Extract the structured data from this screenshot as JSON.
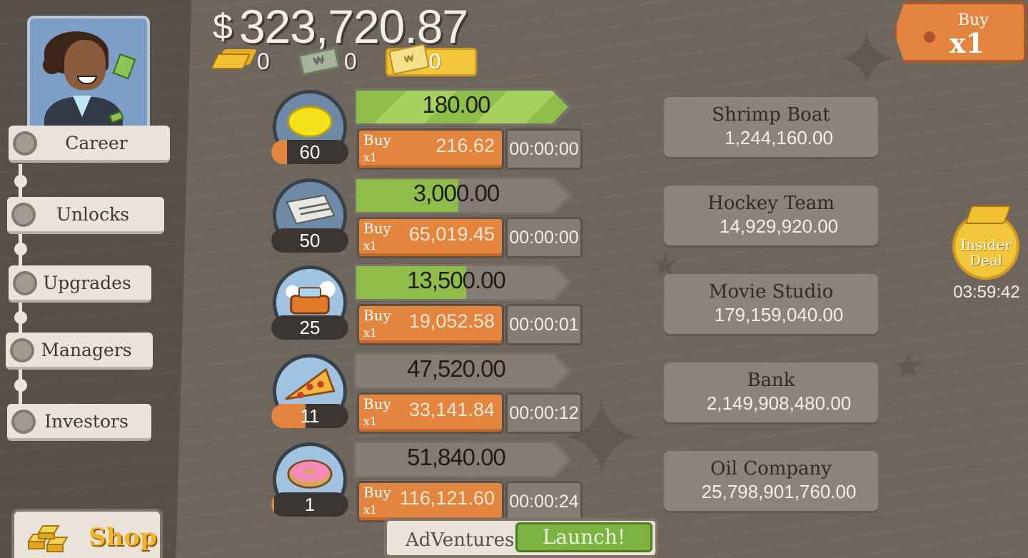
{
  "money": {
    "symbol": "$",
    "value": "323,720.87"
  },
  "currencies": {
    "gold": "0",
    "megabucks": "0",
    "tickets": "0"
  },
  "sidebar": {
    "items": [
      {
        "label": "Career"
      },
      {
        "label": "Unlocks"
      },
      {
        "label": "Upgrades"
      },
      {
        "label": "Managers"
      },
      {
        "label": "Investors"
      }
    ],
    "shop_label": "Shop"
  },
  "businesses": [
    {
      "icon": "lemon-icon",
      "count": "60",
      "count_progress": 0.2,
      "revenue": "180.00",
      "bar_progress": 1.0,
      "buy_label": "Buy",
      "buy_mult": "x1",
      "cost": "216.62",
      "timer": "00:00:00"
    },
    {
      "icon": "newspaper-icon",
      "count": "50",
      "count_progress": 0.0,
      "revenue": "3,000.00",
      "bar_progress": 0.52,
      "buy_label": "Buy",
      "buy_mult": "x1",
      "cost": "65,019.45",
      "timer": "00:00:00"
    },
    {
      "icon": "car-wash-icon",
      "count": "25",
      "count_progress": 0.0,
      "revenue": "13,500.00",
      "bar_progress": 0.56,
      "buy_label": "Buy",
      "buy_mult": "x1",
      "cost": "19,052.58",
      "timer": "00:00:01"
    },
    {
      "icon": "pizza-icon",
      "count": "11",
      "count_progress": 0.44,
      "revenue": "47,520.00",
      "bar_progress": 0.0,
      "buy_label": "Buy",
      "buy_mult": "x1",
      "cost": "33,141.84",
      "timer": "00:00:12"
    },
    {
      "icon": "donut-icon",
      "count": "1",
      "count_progress": 0.04,
      "revenue": "51,840.00",
      "bar_progress": 0.0,
      "buy_label": "Buy",
      "buy_mult": "x1",
      "cost": "116,121.60",
      "timer": "00:00:24"
    }
  ],
  "locked": [
    {
      "name": "Shrimp Boat",
      "price": "1,244,160.00"
    },
    {
      "name": "Hockey Team",
      "price": "14,929,920.00"
    },
    {
      "name": "Movie Studio",
      "price": "179,159,040.00"
    },
    {
      "name": "Bank",
      "price": "2,149,908,480.00"
    },
    {
      "name": "Oil Company",
      "price": "25,798,901,760.00"
    }
  ],
  "buy_multiplier": {
    "label": "Buy",
    "value": "x1"
  },
  "insider": {
    "line1": "Insider",
    "line2": "Deal",
    "timer": "03:59:42"
  },
  "adventures": {
    "label": "AdVentures",
    "launch": "Launch!"
  },
  "colors": {
    "progress_green": "#8ebd4a",
    "buy_orange": "#e3843f",
    "gold": "#f2c63a"
  }
}
